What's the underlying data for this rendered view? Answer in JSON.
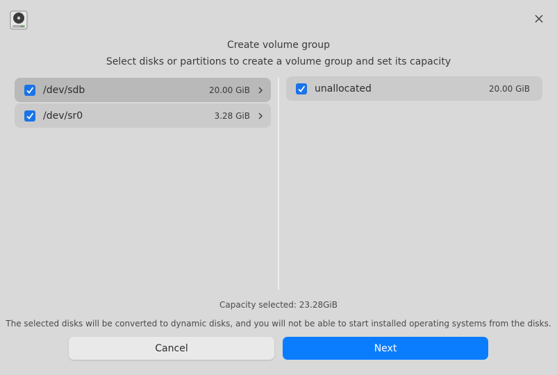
{
  "window": {
    "app_icon": "disk-utility-icon",
    "close_icon": "close-icon"
  },
  "header": {
    "title": "Create volume group",
    "subtitle": "Select disks or partitions to create a volume group and set its capacity"
  },
  "disks": [
    {
      "name": "/dev/sdb",
      "size": "20.00 GiB",
      "checked": true,
      "selected": true
    },
    {
      "name": "/dev/sr0",
      "size": "3.28 GiB",
      "checked": true,
      "selected": false
    }
  ],
  "partitions": [
    {
      "name": "unallocated",
      "size": "20.00 GiB",
      "checked": true
    }
  ],
  "footer": {
    "capacity": "Capacity selected: 23.28GiB",
    "warning": "The selected disks will be converted to dynamic disks, and you will not be able to start installed operating systems from the disks.",
    "cancel_label": "Cancel",
    "next_label": "Next"
  },
  "colors": {
    "accent": "#0a7dff",
    "checkbox": "#1a73e8",
    "background": "#d9d9d9"
  }
}
